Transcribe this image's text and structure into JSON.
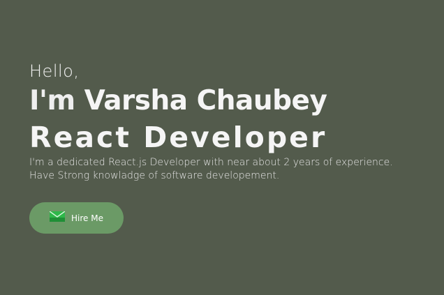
{
  "hero": {
    "greeting": "Hello,",
    "name_prefix": "I'm",
    "name": "Varsha Chaubey",
    "role": "React Developer",
    "description_line1": "I'm a dedicated React.js Developer with near about 2 years of experience.",
    "description_line2": "Have Strong knowladge of software developement."
  },
  "cta": {
    "label": "Hire Me",
    "icon": "mail-icon"
  },
  "colors": {
    "background": "#535b4c",
    "button": "#6b9a66",
    "text": "#f5f5f5"
  }
}
